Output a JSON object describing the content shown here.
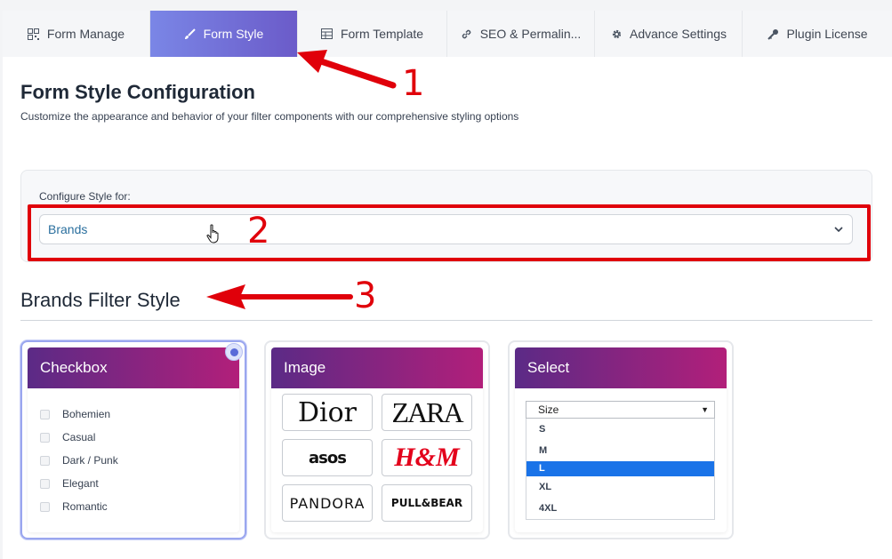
{
  "tabs": [
    {
      "label": "Form Manage",
      "icon": "qr-grid-icon"
    },
    {
      "label": "Form Style",
      "icon": "brush-icon"
    },
    {
      "label": "Form Template",
      "icon": "table-icon"
    },
    {
      "label": "SEO & Permalin...",
      "icon": "link-icon"
    },
    {
      "label": "Advance Settings",
      "icon": "gear-icon"
    },
    {
      "label": "Plugin License",
      "icon": "key-icon"
    }
  ],
  "page": {
    "title": "Form Style Configuration",
    "subtitle": "Customize the appearance and behavior of your filter components with our comprehensive styling options"
  },
  "config": {
    "label": "Configure Style for:",
    "selected": "Brands"
  },
  "section": {
    "title": "Brands Filter Style"
  },
  "annotations": {
    "one": "1",
    "two": "2",
    "three": "3"
  },
  "cards": {
    "checkbox": {
      "title": "Checkbox",
      "items": [
        "Bohemien",
        "Casual",
        "Dark / Punk",
        "Elegant",
        "Romantic"
      ]
    },
    "image": {
      "title": "Image",
      "logos": [
        "Dior",
        "ZARA",
        "asos",
        "H&M",
        "PANDORA",
        "PULL&BEAR"
      ]
    },
    "select": {
      "title": "Select",
      "placeholder": "Size",
      "options": [
        "S",
        "M",
        "L",
        "XL",
        "4XL"
      ],
      "highlighted": "L"
    }
  },
  "colors": {
    "active_tab": "#6b5bc9",
    "card_header_start": "#5b2a86",
    "card_header_end": "#b21f7a",
    "annotation": "#e0000a"
  }
}
